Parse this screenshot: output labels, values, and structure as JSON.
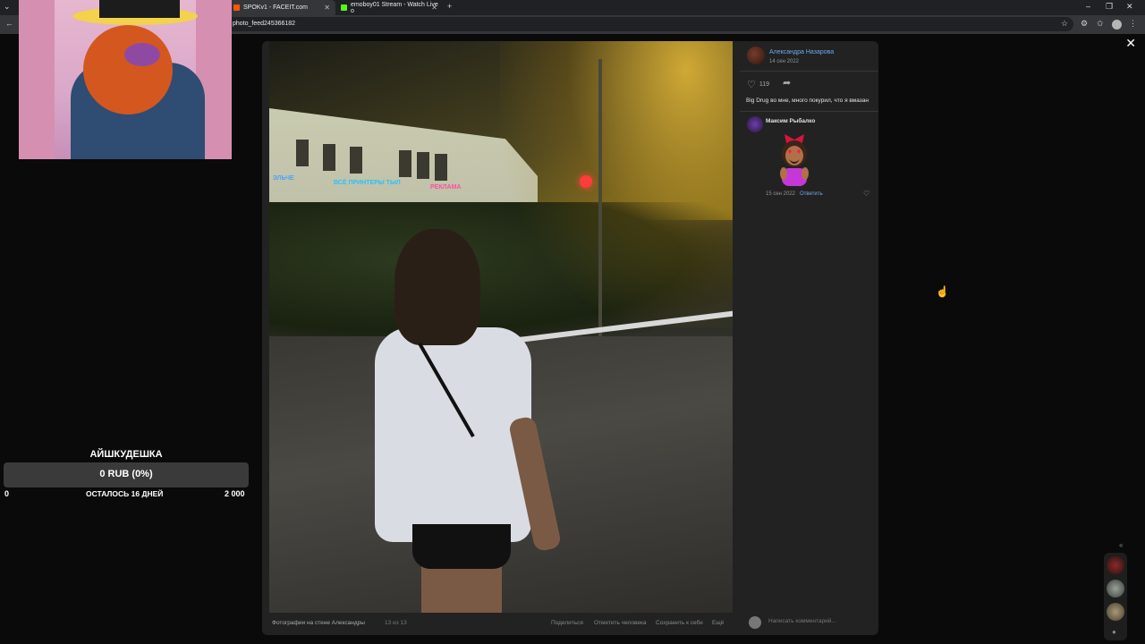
{
  "browser": {
    "tabs": [
      {
        "title": "SPOKv1 - FACEIT.com",
        "active": true
      },
      {
        "title": "emoboy01 Stream - Watch Live o",
        "active": false
      }
    ],
    "new_tab_label": "+",
    "url": "photo_feed245366182"
  },
  "post": {
    "author": "Александра Назарова",
    "date": "14 сен 2022",
    "likes": "119",
    "text": "Big Drug во мне, много покурил, что я вмазан"
  },
  "comment": {
    "author": "Максим Рыбалко",
    "date": "15 сен 2022",
    "reply_label": "Ответить"
  },
  "footer": {
    "album": "Фотографии на стене Александры",
    "counter": "13 из 13",
    "actions": [
      "Поделиться",
      "Отметить человека",
      "Сохранить к себе",
      "Ещё"
    ]
  },
  "write_comment_placeholder": "Написать комментарий...",
  "photo_signs": [
    "ЭЛЬЧЕ",
    "ВСЁ ПРИНТЕРЫ ТЫЛ",
    "РЕКЛАМА"
  ],
  "goal": {
    "title": "АЙШКУДЕШКА",
    "value": "0 RUB (0%)",
    "progress_percent": 0,
    "min": "0",
    "remaining": "ОСТАЛОСЬ 16 ДНЕЙ",
    "max": "2 000"
  },
  "colors": {
    "link": "#71aaeb",
    "modal_bg": "#222222",
    "accent_red": "#ff3b3b"
  }
}
